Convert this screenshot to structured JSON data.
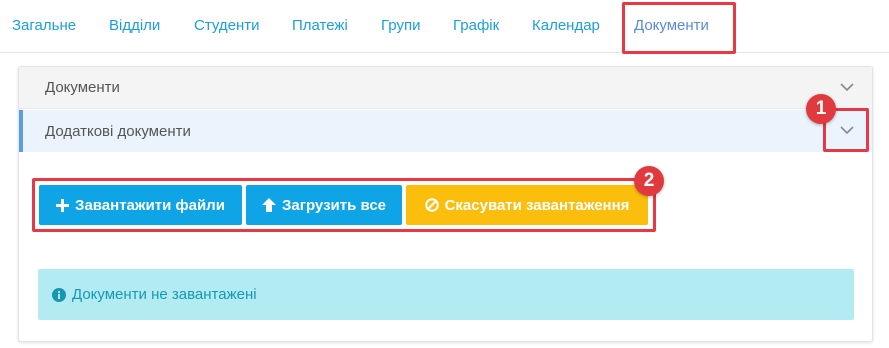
{
  "tabs": [
    {
      "label": "Загальне"
    },
    {
      "label": "Відділи"
    },
    {
      "label": "Студенти"
    },
    {
      "label": "Платежі"
    },
    {
      "label": "Групи"
    },
    {
      "label": "Графік"
    },
    {
      "label": "Календар"
    },
    {
      "label": "Документи",
      "active": true
    }
  ],
  "accordion": {
    "documents_title": "Документи",
    "additional_title": "Додаткові документи"
  },
  "markers": {
    "one": "1",
    "two": "2"
  },
  "buttons": {
    "upload_files": "Завантажити файли",
    "upload_all": "Загрузить все",
    "cancel_upload": "Скасувати завантаження"
  },
  "alert": {
    "text": "Документи не завантажені"
  },
  "colors": {
    "tab_text": "#1e9ed9",
    "accent_red": "#e53945",
    "button_blue": "#0ea4e6",
    "button_yellow": "#fbbe0d",
    "alert_bg": "#b2ebf2"
  },
  "icons": {
    "plus": "plus-icon",
    "upload": "arrow-up-icon",
    "cancel": "ban-icon",
    "info": "info-circle-icon",
    "chevron": "chevron-down-icon"
  }
}
